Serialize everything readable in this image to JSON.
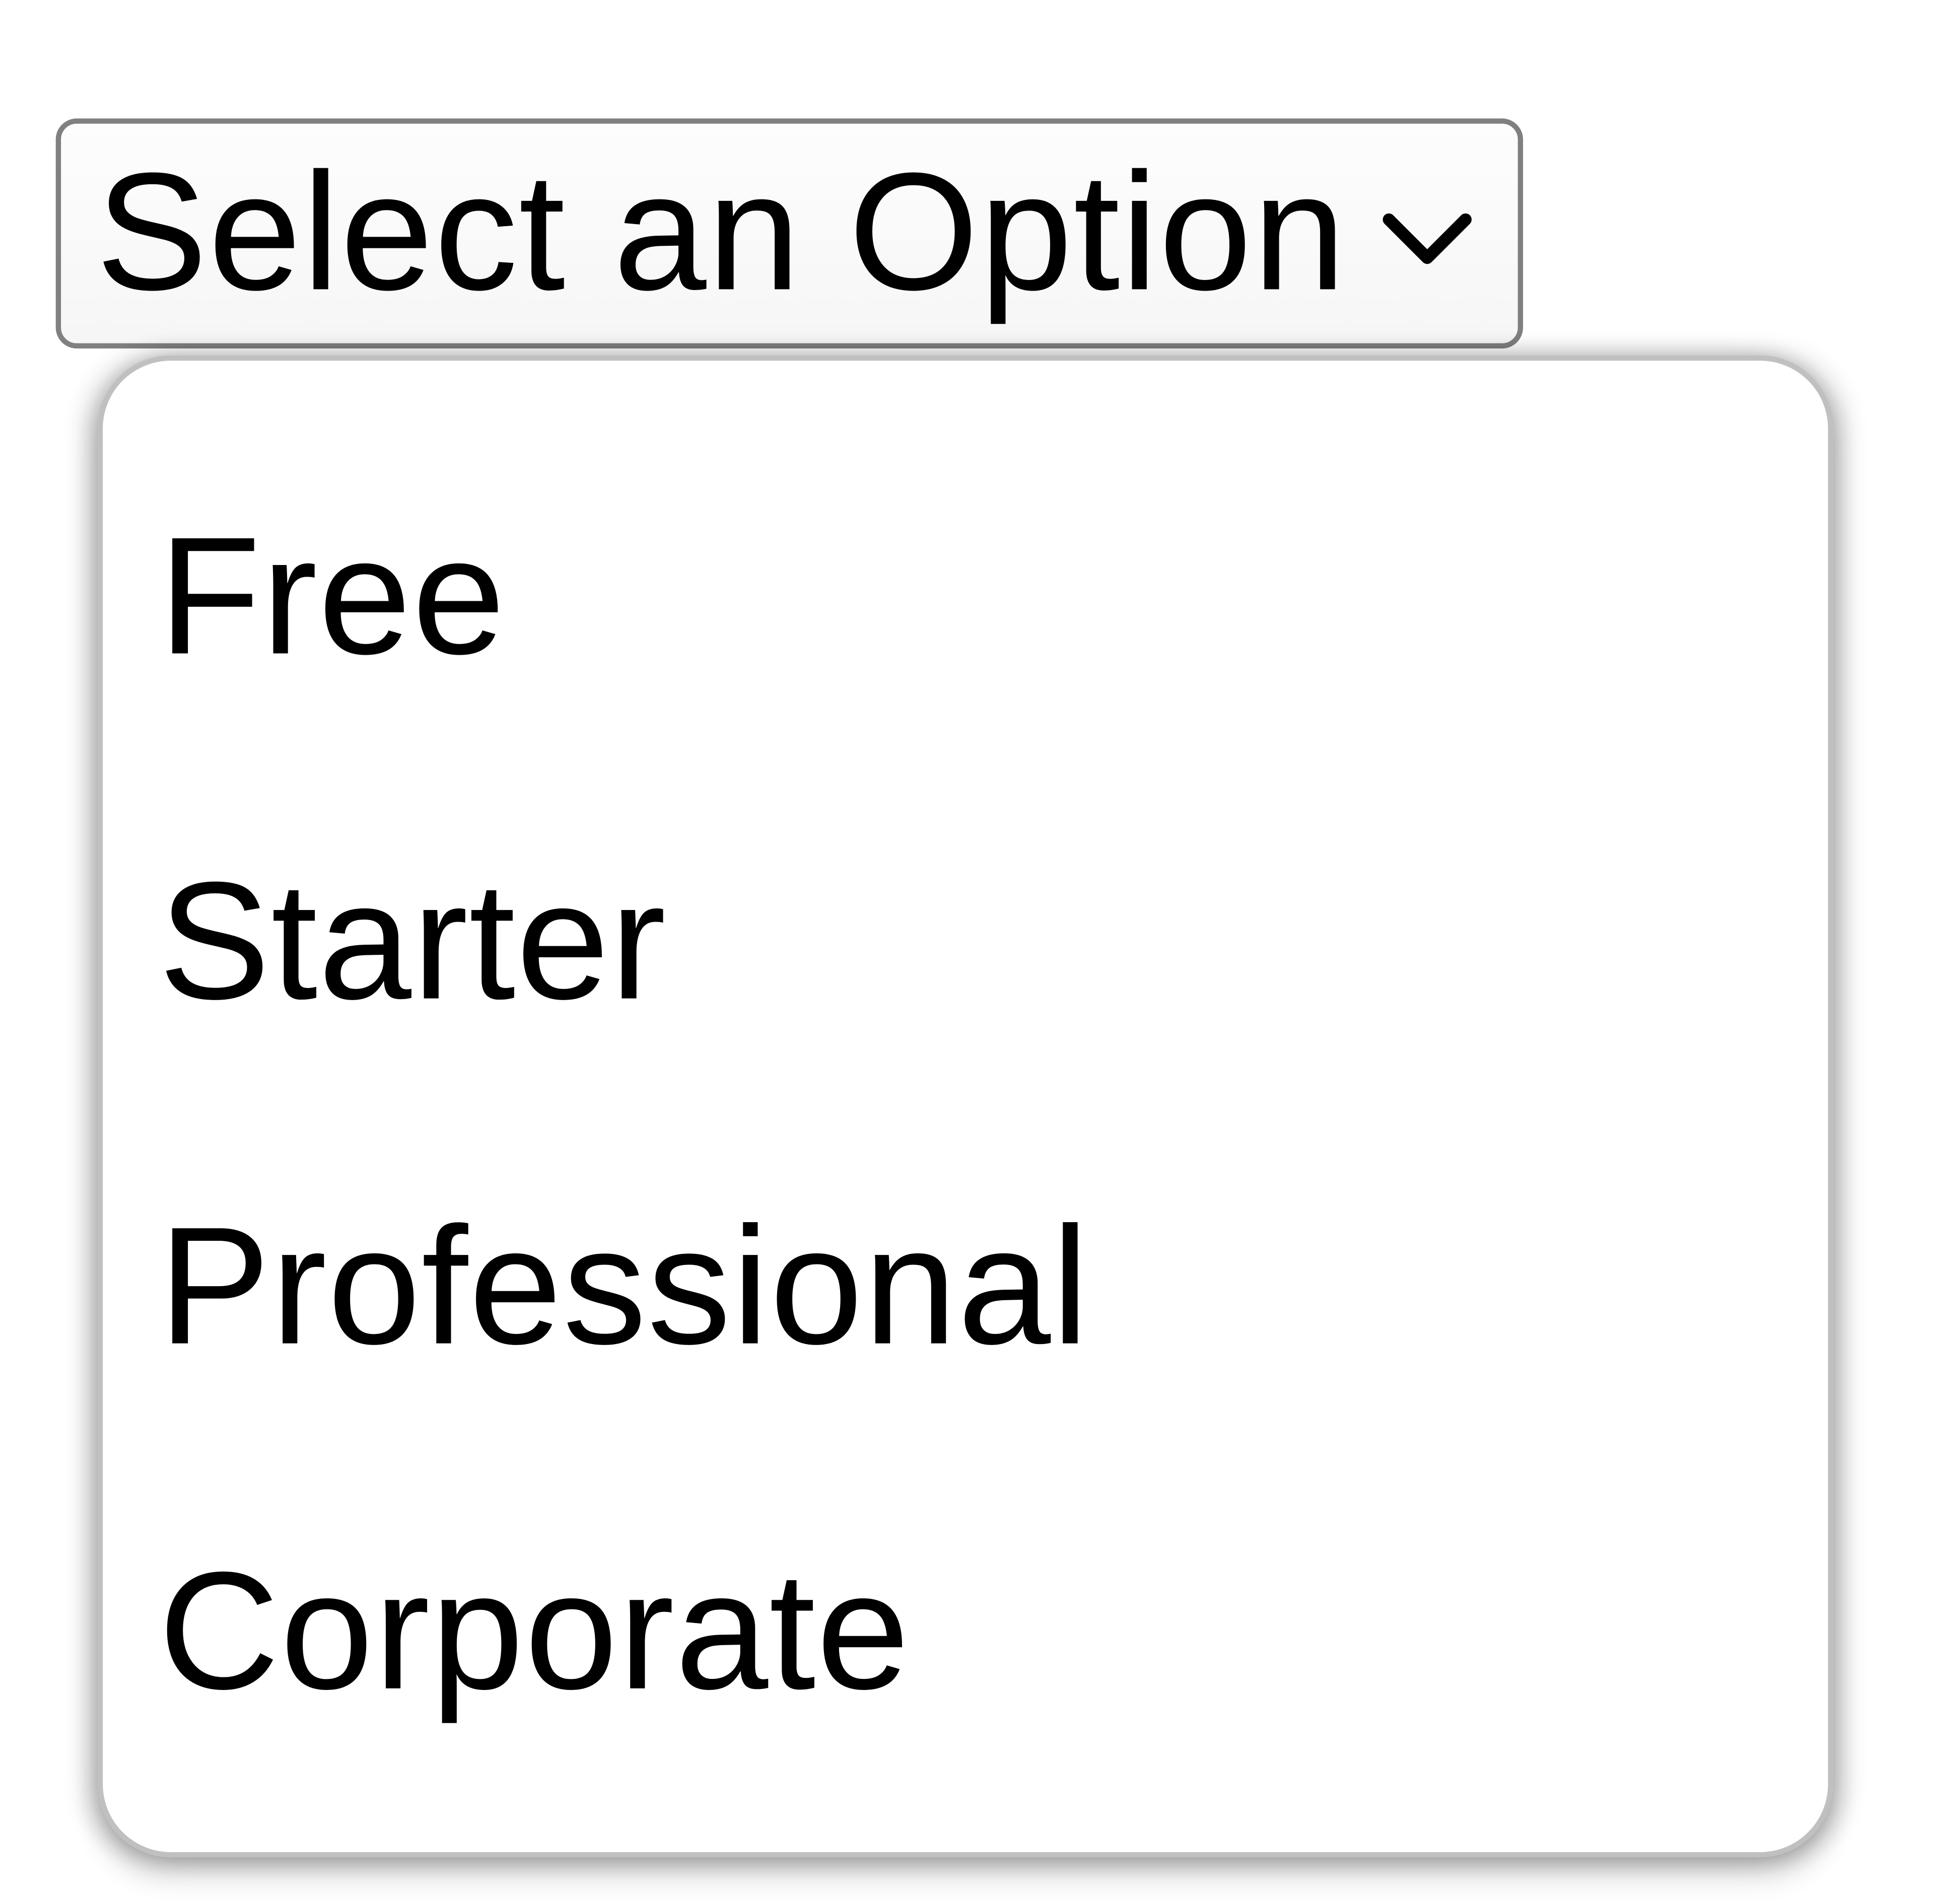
{
  "select": {
    "placeholder": "Select an Option",
    "chevron_icon": "chevron-down-icon",
    "options": [
      {
        "label": "Free"
      },
      {
        "label": "Starter"
      },
      {
        "label": "Professional"
      },
      {
        "label": "Corporate"
      }
    ]
  }
}
